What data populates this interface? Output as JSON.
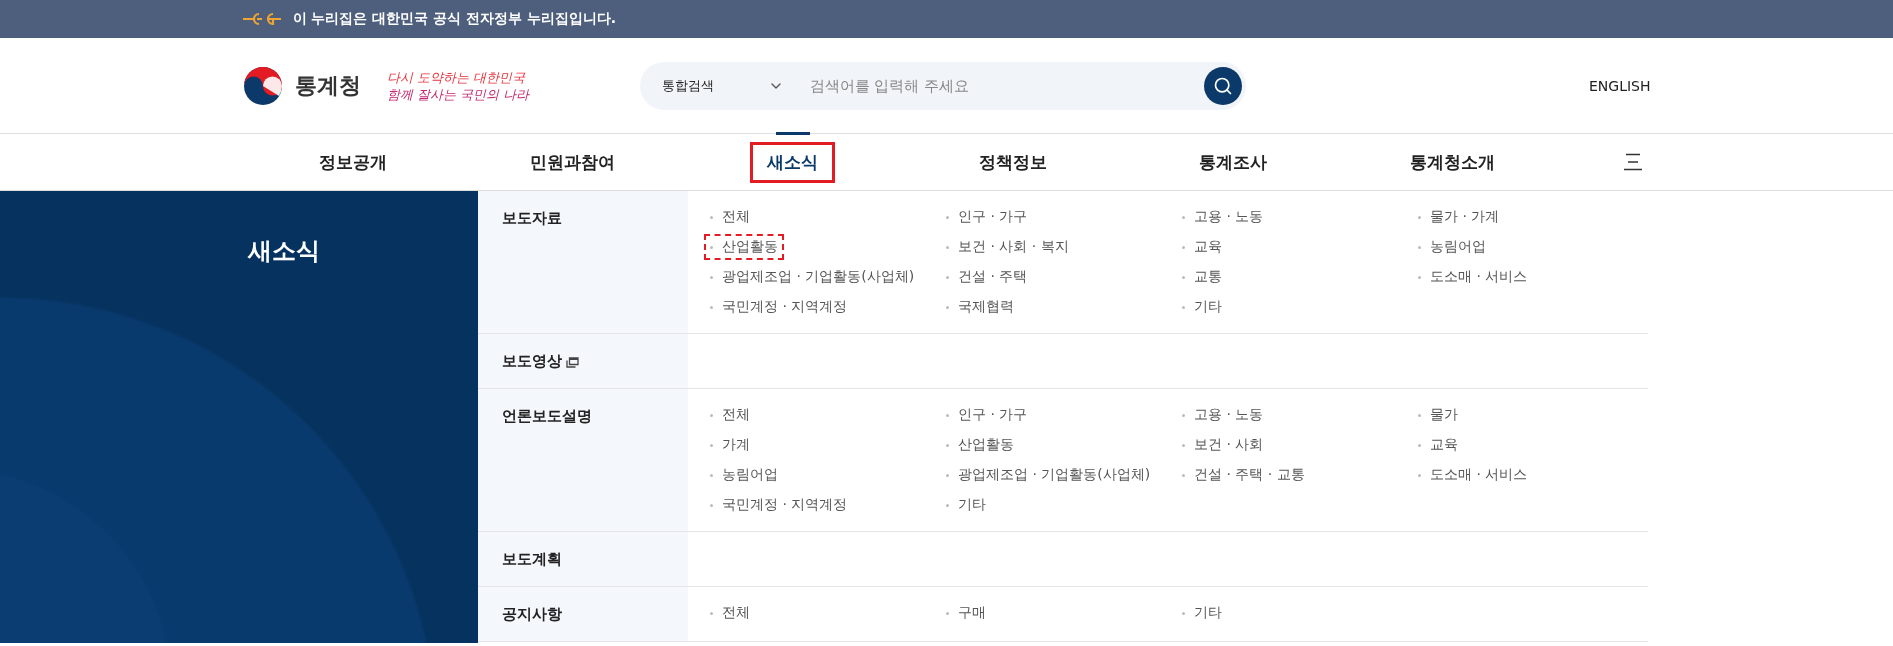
{
  "gov_bar": {
    "text": "이 누리집은 대한민국 공식 전자정부 누리집입니다."
  },
  "header": {
    "logo_text": "통계청",
    "slogan": [
      "다시 도약하는 대한민국",
      "함께 잘사는 국민의 나라"
    ],
    "search": {
      "scope": "통합검색",
      "placeholder": "검색어를 입력해 주세요"
    },
    "language_link": "ENGLISH"
  },
  "nav": [
    {
      "label": "정보공개",
      "selected": false,
      "marked": false
    },
    {
      "label": "민원과참여",
      "selected": false,
      "marked": false
    },
    {
      "label": "새소식",
      "selected": true,
      "marked": true
    },
    {
      "label": "정책정보",
      "selected": false,
      "marked": false
    },
    {
      "label": "통계조사",
      "selected": false,
      "marked": false
    },
    {
      "label": "통계청소개",
      "selected": false,
      "marked": false
    }
  ],
  "side_panel": {
    "title": "새소식"
  },
  "sections": [
    {
      "label": "보도자료",
      "external": false,
      "items": [
        {
          "label": "전체",
          "marked": false
        },
        {
          "label": "인구 · 가구",
          "marked": false
        },
        {
          "label": "고용 · 노동",
          "marked": false
        },
        {
          "label": "물가 · 가계",
          "marked": false
        },
        {
          "label": "산업활동",
          "marked": true
        },
        {
          "label": "보건 · 사회 · 복지",
          "marked": false
        },
        {
          "label": "교육",
          "marked": false
        },
        {
          "label": "농림어업",
          "marked": false
        },
        {
          "label": "광업제조업 · 기업활동(사업체)",
          "marked": false
        },
        {
          "label": "건설 · 주택",
          "marked": false
        },
        {
          "label": "교통",
          "marked": false
        },
        {
          "label": "도소매 · 서비스",
          "marked": false
        },
        {
          "label": "국민계정 · 지역계정",
          "marked": false
        },
        {
          "label": "국제협력",
          "marked": false
        },
        {
          "label": "기타",
          "marked": false
        }
      ]
    },
    {
      "label": "보도영상",
      "external": true
    },
    {
      "label": "언론보도설명",
      "external": false,
      "items": [
        {
          "label": "전체",
          "marked": false
        },
        {
          "label": "인구 · 가구",
          "marked": false
        },
        {
          "label": "고용 · 노동",
          "marked": false
        },
        {
          "label": "물가",
          "marked": false
        },
        {
          "label": "가계",
          "marked": false
        },
        {
          "label": "산업활동",
          "marked": false
        },
        {
          "label": "보건 · 사회",
          "marked": false
        },
        {
          "label": "교육",
          "marked": false
        },
        {
          "label": "농림어업",
          "marked": false
        },
        {
          "label": "광업제조업 · 기업활동(사업체)",
          "marked": false
        },
        {
          "label": "건설 · 주택 · 교통",
          "marked": false
        },
        {
          "label": "도소매 · 서비스",
          "marked": false
        },
        {
          "label": "국민계정 · 지역계정",
          "marked": false
        },
        {
          "label": "기타",
          "marked": false
        }
      ]
    },
    {
      "label": "보도계획",
      "external": false
    },
    {
      "label": "공지사항",
      "external": false,
      "items": [
        {
          "label": "전체",
          "marked": false
        },
        {
          "label": "구매",
          "marked": false
        },
        {
          "label": "기타",
          "marked": false
        }
      ]
    }
  ]
}
